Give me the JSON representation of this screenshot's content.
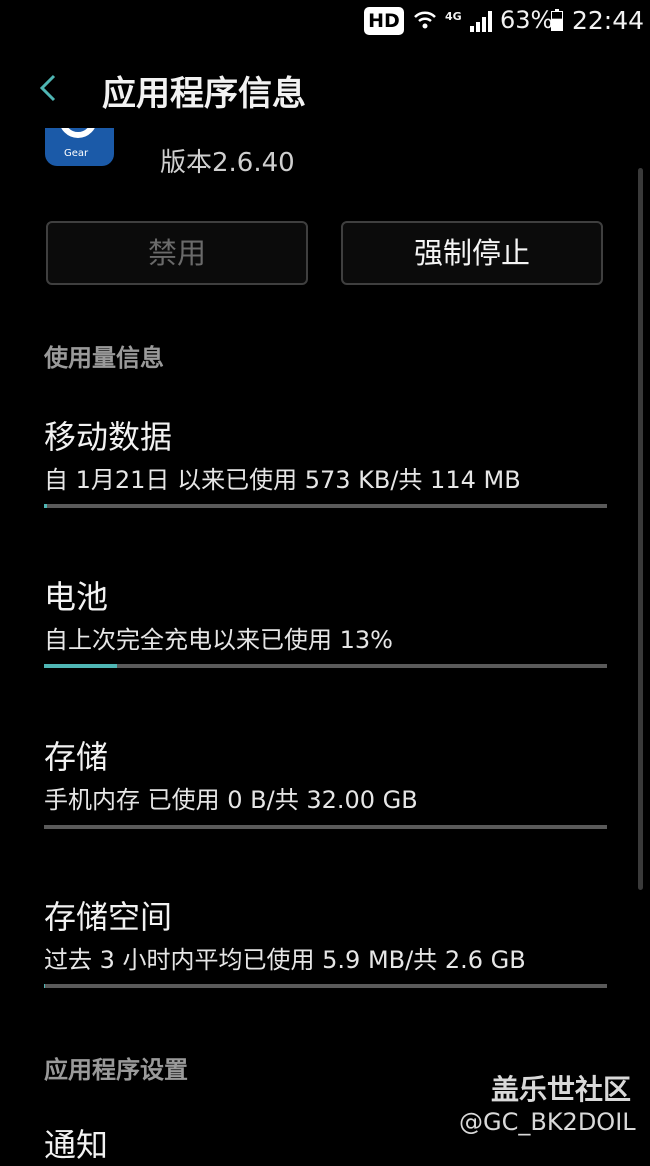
{
  "status_bar": {
    "hd_badge": "HD",
    "network": "4G",
    "battery_percent": "63%",
    "battery_level": 0.63,
    "time": "22:44"
  },
  "header": {
    "title": "应用程序信息",
    "back_icon": "chevron-left-icon"
  },
  "app": {
    "icon_text": "Gear",
    "version": "版本2.6.40"
  },
  "buttons": {
    "disable_label": "禁用",
    "force_stop_label": "强制停止"
  },
  "usage_section": {
    "header": "使用量信息",
    "items": [
      {
        "title": "移动数据",
        "subtitle": "自 1月21日 以来已使用 573 KB/共 114 MB",
        "progress": 0.005
      },
      {
        "title": "电池",
        "subtitle": "自上次完全充电以来已使用 13%",
        "progress": 0.13
      },
      {
        "title": "存储",
        "subtitle": "手机内存 已使用 0 B/共 32.00 GB",
        "progress": 0
      },
      {
        "title": "存储空间",
        "subtitle": "过去 3 小时内平均已使用 5.9 MB/共 2.6 GB",
        "progress": 0.002
      }
    ]
  },
  "settings_section": {
    "header": "应用程序设置",
    "first_item": "通知"
  },
  "watermark": {
    "line1": "盖乐世社区",
    "line2": "@GC_BK2DOIL"
  },
  "colors": {
    "accent": "#4fb6b4",
    "background": "#000000"
  }
}
